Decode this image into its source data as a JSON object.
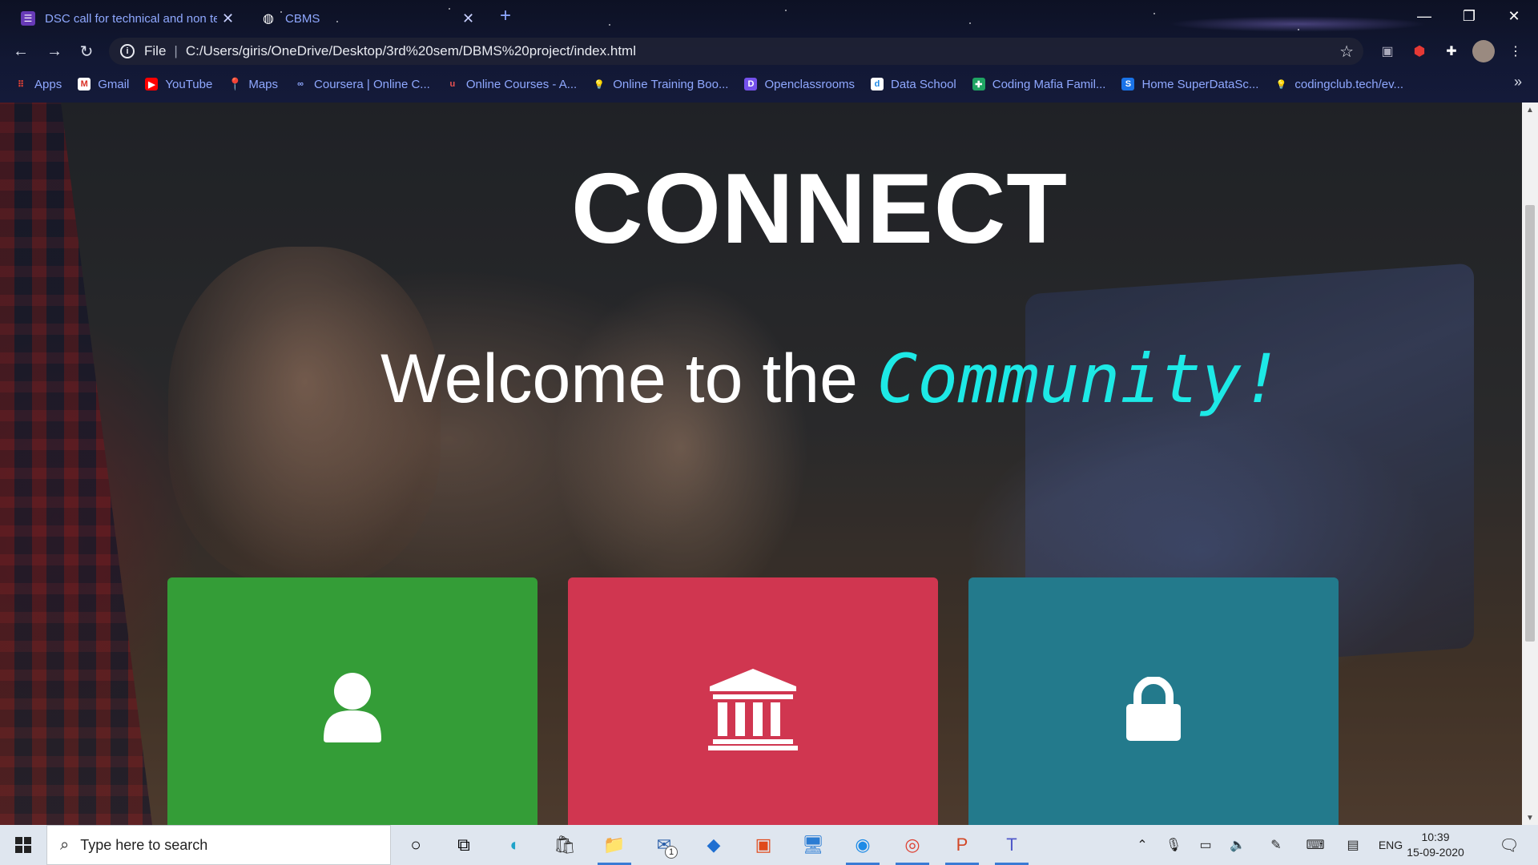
{
  "browser": {
    "tabs": [
      {
        "title": "DSC call for technical and non te",
        "close": "✕"
      },
      {
        "title": "CBMS",
        "close": "✕"
      }
    ],
    "new_tab": "+",
    "window": {
      "minimize": "—",
      "restore": "❐",
      "close": "✕"
    },
    "address": {
      "scheme": "File",
      "url": "C:/Users/giris/OneDrive/Desktop/3rd%20sem/DBMS%20project/index.html"
    },
    "bookmarks": [
      {
        "label": "Apps",
        "icon": "apps-grid-icon",
        "color": "#ea4335"
      },
      {
        "label": "Gmail",
        "icon": "gmail-icon",
        "color": "#d93025"
      },
      {
        "label": "YouTube",
        "icon": "youtube-icon",
        "color": "#ff0000"
      },
      {
        "label": "Maps",
        "icon": "maps-pin-icon",
        "color": "#34a853"
      },
      {
        "label": "Coursera | Online C...",
        "icon": "coursera-icon",
        "color": "#2a73cc"
      },
      {
        "label": "Online Courses - A...",
        "icon": "udemy-icon",
        "color": "#ec5252"
      },
      {
        "label": "Online Training Boo...",
        "icon": "bulb-icon",
        "color": "#ffffff"
      },
      {
        "label": "Openclassrooms",
        "icon": "openclassrooms-icon",
        "color": "#7451eb"
      },
      {
        "label": "Data School",
        "icon": "dataschool-icon",
        "color": "#1e88e5"
      },
      {
        "label": "Coding Mafia Famil...",
        "icon": "green-plus-icon",
        "color": "#1fa463"
      },
      {
        "label": "Home SuperDataSc...",
        "icon": "superdatascience-icon",
        "color": "#1a73e8"
      },
      {
        "label": "codingclub.tech/ev...",
        "icon": "bulb-icon",
        "color": "#ffffff"
      }
    ],
    "bookmarks_more": "»"
  },
  "page": {
    "title": "CONNECT",
    "welcome_prefix": "Welcome to the ",
    "welcome_highlight": "Community!",
    "highlight_color": "#1de9e6",
    "cards": [
      {
        "icon": "user-icon",
        "color": "#349d37"
      },
      {
        "icon": "institution-icon",
        "color": "#d03650"
      },
      {
        "icon": "lock-icon",
        "color": "#237a8c"
      }
    ]
  },
  "taskbar": {
    "search_placeholder": "Type here to search",
    "mail_badge": "1",
    "language": "ENG",
    "time": "10:39",
    "date": "15-09-2020"
  }
}
